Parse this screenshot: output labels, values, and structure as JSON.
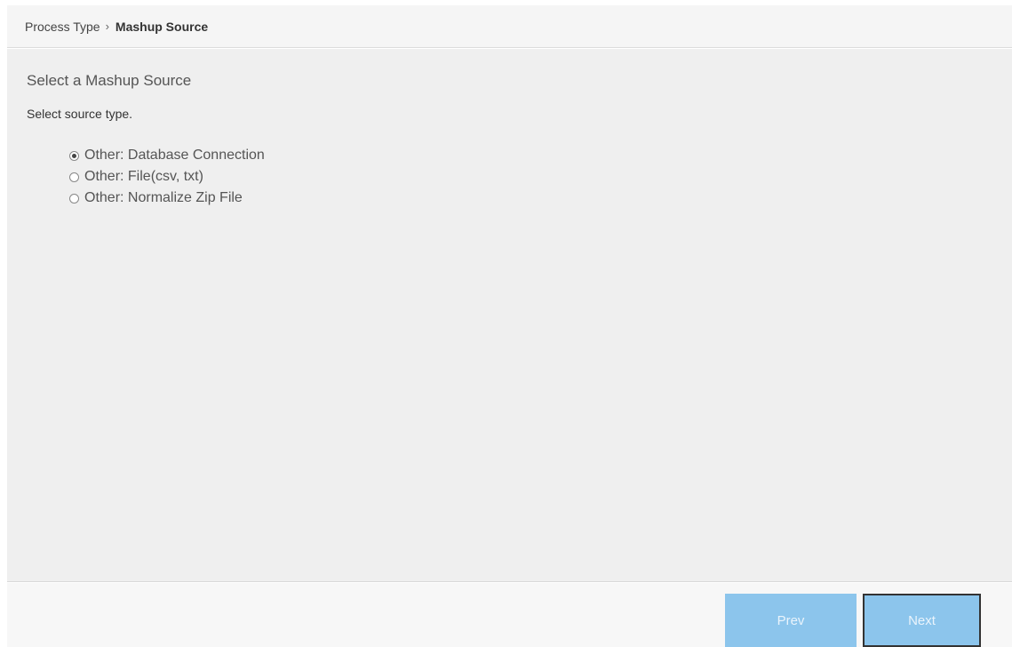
{
  "breadcrumb": {
    "parent": "Process Type",
    "separator": "›",
    "current": "Mashup Source"
  },
  "main": {
    "heading": "Select a Mashup Source",
    "subheading": "Select source type.",
    "options": [
      {
        "label": "Other: Database Connection",
        "selected": true
      },
      {
        "label": "Other: File(csv, txt)",
        "selected": false
      },
      {
        "label": "Other: Normalize Zip File",
        "selected": false
      }
    ]
  },
  "footer": {
    "prev_label": "Prev",
    "next_label": "Next"
  },
  "colors": {
    "button_bg": "#8cc5ec",
    "content_bg": "#efefef"
  }
}
